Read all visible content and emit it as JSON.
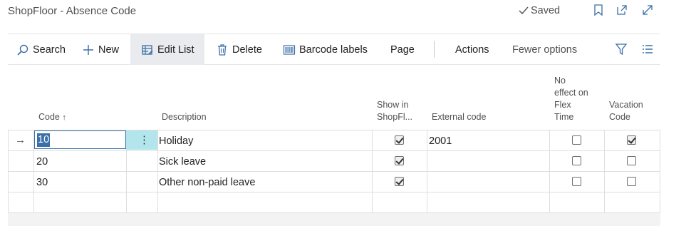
{
  "header": {
    "title": "ShopFloor - Absence Code",
    "saved_label": "Saved",
    "icons": [
      "bookmark-icon",
      "open-new-window-icon",
      "expand-icon"
    ]
  },
  "toolbar": {
    "search": "Search",
    "new": "New",
    "edit_list": "Edit List",
    "delete": "Delete",
    "barcode_labels": "Barcode labels",
    "page": "Page",
    "actions": "Actions",
    "fewer_options": "Fewer options"
  },
  "grid": {
    "columns": {
      "code": "Code",
      "description": "Description",
      "show_in_shopfloor": [
        "Show in",
        "ShopFl..."
      ],
      "external_code": "External code",
      "no_effect_flex_time": [
        "No",
        "effect on",
        "Flex",
        "Time"
      ],
      "vacation_code": [
        "Vacation",
        "Code"
      ]
    },
    "rows": [
      {
        "code": "10",
        "description": "Holiday",
        "show_in_shopfloor": true,
        "external_code": "2001",
        "no_effect_flex_time": false,
        "vacation_code": true
      },
      {
        "code": "20",
        "description": "Sick leave",
        "show_in_shopfloor": true,
        "external_code": "",
        "no_effect_flex_time": false,
        "vacation_code": false
      },
      {
        "code": "30",
        "description": "Other non-paid leave",
        "show_in_shopfloor": true,
        "external_code": "",
        "no_effect_flex_time": false,
        "vacation_code": false
      }
    ]
  },
  "colors": {
    "accent": "#3a6fa8",
    "selection_cell": "#b3e5ec",
    "active_toolbar": "#e9ebee"
  }
}
